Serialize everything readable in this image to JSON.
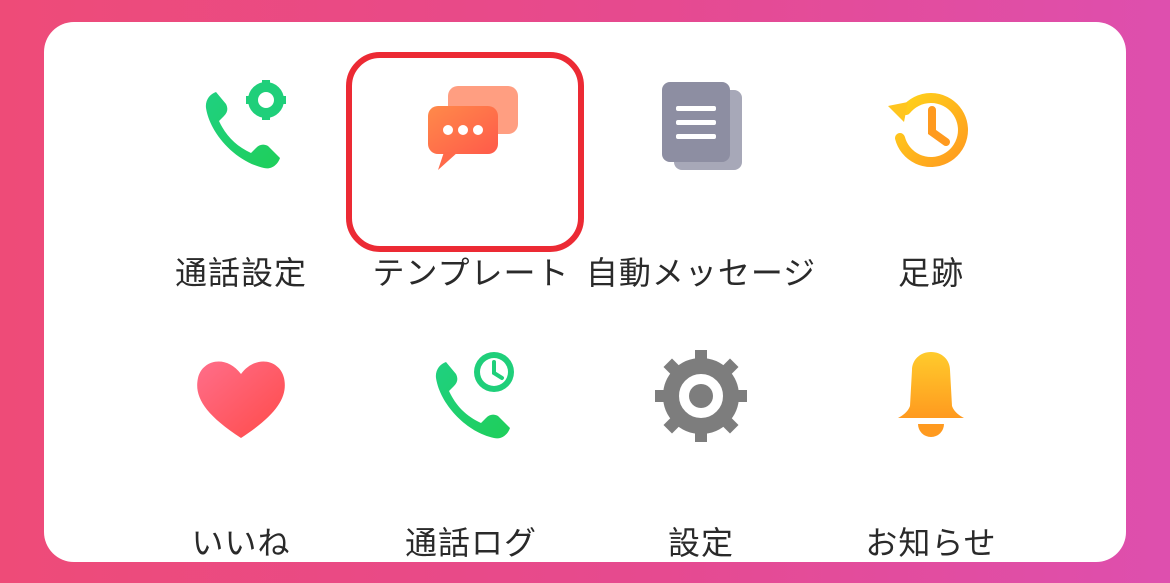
{
  "menu": {
    "items": [
      {
        "label": "通話設定",
        "icon": "phone-gear-icon"
      },
      {
        "label": "テンプレート",
        "icon": "chat-bubbles-icon",
        "highlighted": true
      },
      {
        "label": "自動メッセージ",
        "icon": "documents-icon"
      },
      {
        "label": "足跡",
        "icon": "history-clock-icon"
      },
      {
        "label": "いいね",
        "icon": "heart-icon"
      },
      {
        "label": "通話ログ",
        "icon": "phone-clock-icon"
      },
      {
        "label": "設定",
        "icon": "gear-icon"
      },
      {
        "label": "お知らせ",
        "icon": "bell-icon"
      }
    ]
  },
  "colors": {
    "background_start": "#ee4b78",
    "background_end": "#de4fae",
    "highlight_border": "#ec2a34",
    "green": "#1fd070",
    "orange": "#ff7a45",
    "gray": "#8f8f9f"
  }
}
